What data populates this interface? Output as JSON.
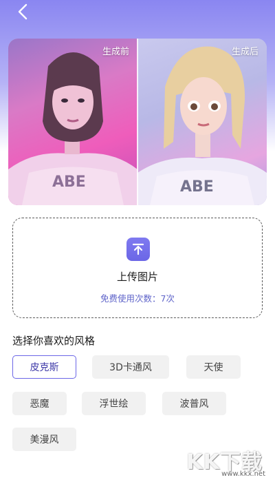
{
  "header": {
    "back_icon": "chevron-left-icon"
  },
  "compare": {
    "before_label": "生成前",
    "after_label": "生成后"
  },
  "upload": {
    "icon": "upload-icon",
    "label": "上传图片",
    "free_count_text": "免费使用次数：7次"
  },
  "styles": {
    "title": "选择你喜欢的风格",
    "selected": "皮克斯",
    "items": [
      {
        "label": "皮克斯"
      },
      {
        "label": "3D卡通风"
      },
      {
        "label": "天使"
      },
      {
        "label": "恶魔"
      },
      {
        "label": "浮世绘"
      },
      {
        "label": "波普风"
      },
      {
        "label": "美漫风"
      }
    ]
  },
  "watermark": {
    "logo_text": "KK下载",
    "url": "www.kkx.net"
  },
  "colors": {
    "accent": "#6b66e6",
    "header_gradient_top": "#8a86f1",
    "free_count": "#5e63c9",
    "chip_bg": "#f1f1f1"
  }
}
